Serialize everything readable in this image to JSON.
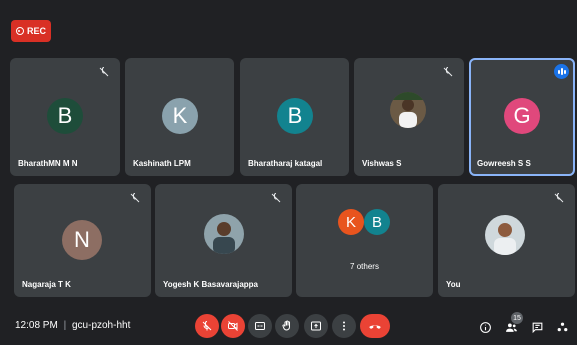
{
  "recording": {
    "label": "REC"
  },
  "participants_row1": [
    {
      "name": "BharathMN M N",
      "initial": "B",
      "color": "#1e4d3a",
      "muted": true
    },
    {
      "name": "Kashinath LPM",
      "initial": "K",
      "color": "#8aa2ad",
      "muted": false
    },
    {
      "name": "Bharatharaj katagal",
      "initial": "B",
      "color": "#12838f",
      "muted": false
    },
    {
      "name": "Vishwas S",
      "initial": "",
      "color": "#6b5a45",
      "muted": true,
      "photo": true
    },
    {
      "name": "Gowreesh S S",
      "initial": "G",
      "color": "#e0487c",
      "muted": false,
      "speaking": true
    }
  ],
  "participants_row2": [
    {
      "name": "Nagaraja T K",
      "initial": "N",
      "color": "#8d6e63",
      "muted": true
    },
    {
      "name": "Yogesh K Basavarajappa",
      "initial": "",
      "color": "#5b6b72",
      "muted": true,
      "photo": true
    },
    {
      "name": "7 others",
      "initials": [
        "K",
        "B"
      ],
      "colors": [
        "#e8541e",
        "#12838f"
      ]
    },
    {
      "name": "You",
      "initial": "",
      "color": "#b0bec5",
      "muted": true,
      "photo": true
    }
  ],
  "meeting": {
    "time": "12:08 PM",
    "separator": "|",
    "code": "gcu-pzoh-hht"
  },
  "people_count": "15",
  "colors": {
    "background": "#202124",
    "tile": "#3c4043",
    "danger": "#ea4335",
    "accent": "#1a73e8"
  }
}
